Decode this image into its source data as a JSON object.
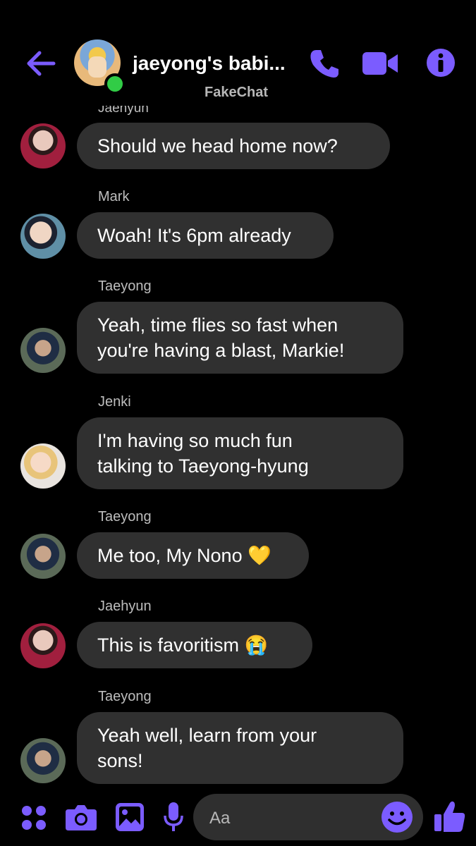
{
  "header": {
    "title": "jaeyong's babi...",
    "subtitle": "FakeChat",
    "accent_color": "#7b5cff",
    "icons": [
      "back-arrow-icon",
      "phone-icon",
      "video-camera-icon",
      "info-icon"
    ]
  },
  "cut_sender": "Jaehyun",
  "messages": [
    {
      "sender": "",
      "lines": [
        "Should we head home now?"
      ],
      "avatar": "jaehyun"
    },
    {
      "sender": "Mark",
      "lines": [
        "Woah! It's 6pm already"
      ],
      "avatar": "mark"
    },
    {
      "sender": "Taeyong",
      "lines": [
        "Yeah, time flies so fast when",
        "you're having a blast, Markie!"
      ],
      "avatar": "taeyong"
    },
    {
      "sender": "Jenki",
      "lines": [
        "I'm having so much fun",
        "talking to Taeyong-hyung"
      ],
      "avatar": "jenki"
    },
    {
      "sender": "Taeyong",
      "lines": [
        "Me too, My Nono 💛"
      ],
      "avatar": "taeyong"
    },
    {
      "sender": "Jaehyun",
      "lines": [
        "This is favoritism 😭"
      ],
      "avatar": "jaehyun"
    },
    {
      "sender": "Taeyong",
      "lines": [
        "Yeah well, learn from your",
        "sons!"
      ],
      "avatar": "taeyong"
    }
  ],
  "composer": {
    "placeholder": "Aa",
    "icons": [
      "apps-icon",
      "camera-icon",
      "gallery-icon",
      "microphone-icon",
      "emoji-icon",
      "thumbs-up-icon"
    ]
  }
}
